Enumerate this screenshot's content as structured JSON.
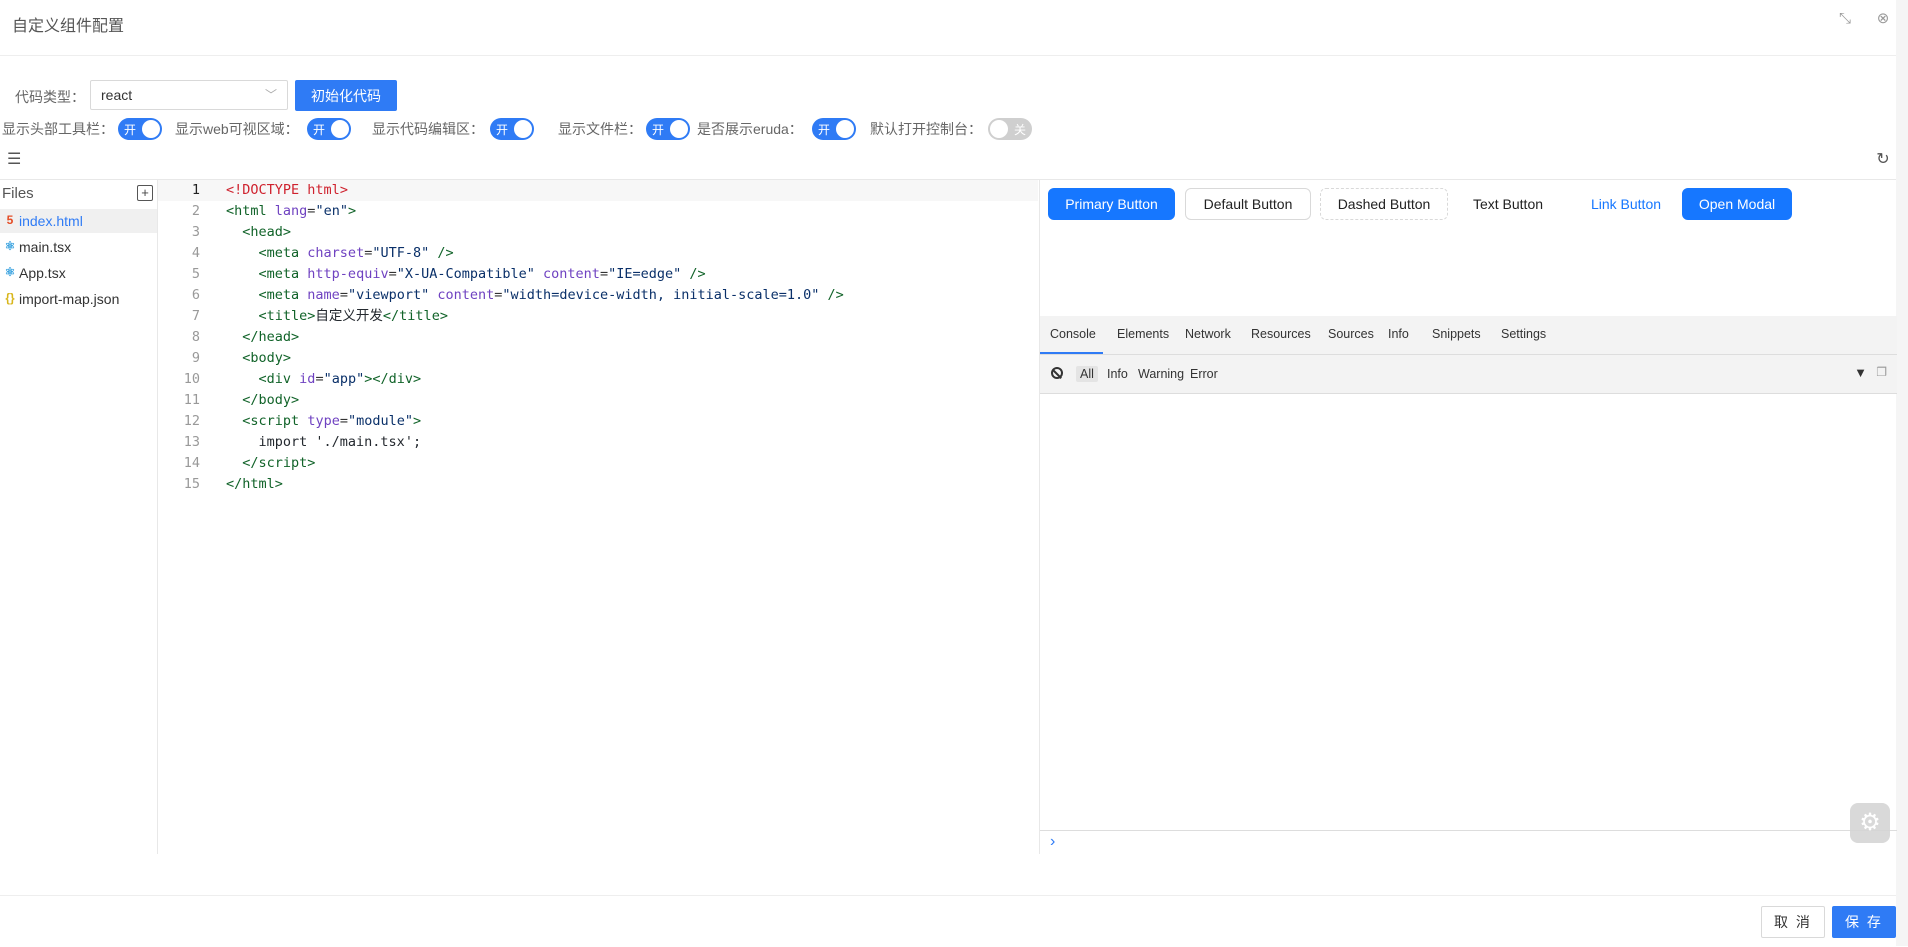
{
  "dialog": {
    "title": "自定义组件配置"
  },
  "toolbar": {
    "code_type_label": "代码类型：",
    "code_type_value": "react",
    "init_button": "初始化代码",
    "toggles": [
      {
        "label": "显示头部工具栏：",
        "state": "开",
        "on": true
      },
      {
        "label": "显示web可视区域：",
        "state": "开",
        "on": true
      },
      {
        "label": "显示代码编辑区：",
        "state": "开",
        "on": true
      },
      {
        "label": "显示文件栏：",
        "state": "开",
        "on": true
      },
      {
        "label": "是否展示eruda：",
        "state": "开",
        "on": true
      },
      {
        "label": "默认打开控制台：",
        "state": "关",
        "on": false
      }
    ]
  },
  "files": {
    "title": "Files",
    "items": [
      {
        "name": "index.html",
        "icon": "html5-icon",
        "glyph": "5",
        "color": "#e44d26",
        "active": true
      },
      {
        "name": "main.tsx",
        "icon": "react-icon",
        "glyph": "⚛",
        "color": "#3da4e0",
        "active": false
      },
      {
        "name": "App.tsx",
        "icon": "react-icon",
        "glyph": "⚛",
        "color": "#3da4e0",
        "active": false
      },
      {
        "name": "import-map.json",
        "icon": "json-icon",
        "glyph": "{}",
        "color": "#d8b61c",
        "active": false
      }
    ]
  },
  "editor": {
    "line_numbers": [
      "1",
      "2",
      "3",
      "4",
      "5",
      "6",
      "7",
      "8",
      "9",
      "10",
      "11",
      "12",
      "13",
      "14",
      "15"
    ],
    "current_line": 1
  },
  "preview": {
    "buttons": [
      {
        "label": "Primary Button",
        "variant": "primary"
      },
      {
        "label": "Default Button",
        "variant": "default"
      },
      {
        "label": "Dashed Button",
        "variant": "dashed"
      },
      {
        "label": "Text Button",
        "variant": "text"
      },
      {
        "label": "Link Button",
        "variant": "link"
      },
      {
        "label": "Open Modal",
        "variant": "primary"
      }
    ]
  },
  "devtools": {
    "tabs": [
      "Console",
      "Elements",
      "Network",
      "Resources",
      "Sources",
      "Info",
      "Snippets",
      "Settings"
    ],
    "active_tab": "Console",
    "filters": [
      "All",
      "Info",
      "Warning",
      "Error"
    ],
    "active_filter": "All",
    "prompt": "›"
  },
  "footer": {
    "cancel": "取 消",
    "save": "保 存"
  },
  "colors": {
    "primary": "#2f7bf5",
    "antd_primary": "#1677ff"
  }
}
